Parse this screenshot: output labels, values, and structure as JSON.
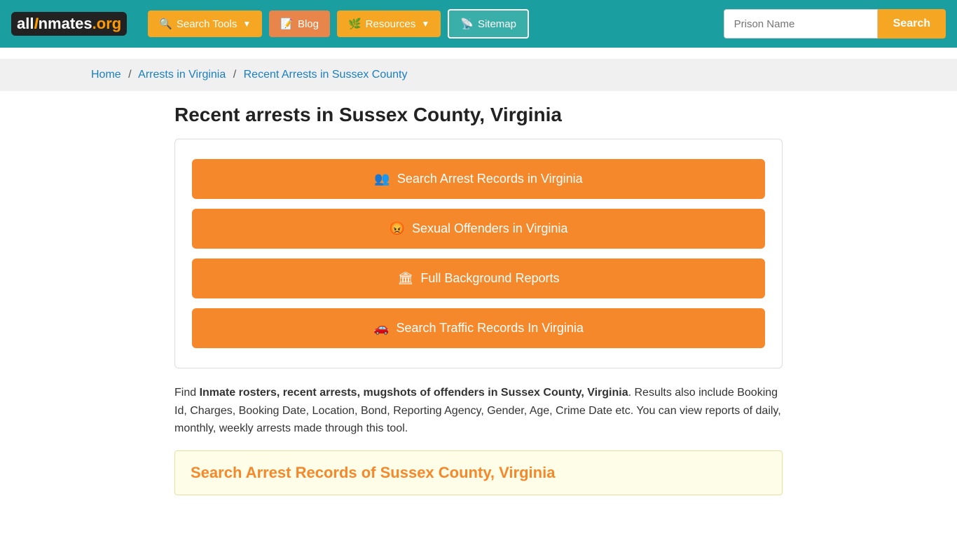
{
  "nav": {
    "logo_all": "all",
    "logo_inmates": "Inmates",
    "logo_org": ".org",
    "search_tools": "Search Tools",
    "blog": "Blog",
    "resources": "Resources",
    "sitemap": "Sitemap",
    "prison_name_placeholder": "Prison Name",
    "search_btn": "Search"
  },
  "breadcrumb": {
    "home": "Home",
    "arrests_in_virginia": "Arrests in Virginia",
    "current": "Recent Arrests in Sussex County"
  },
  "page": {
    "title": "Recent arrests in Sussex County, Virginia",
    "buttons": [
      {
        "id": "search-arrest",
        "icon": "users",
        "label": "Search Arrest Records in Virginia"
      },
      {
        "id": "sexual-offenders",
        "icon": "angry",
        "label": "Sexual Offenders in Virginia"
      },
      {
        "id": "background-reports",
        "icon": "building",
        "label": "Full Background Reports"
      },
      {
        "id": "traffic-records",
        "icon": "car",
        "label": "Search Traffic Records In Virginia"
      }
    ],
    "desc_part1": "Find ",
    "desc_bold": "Inmate rosters, recent arrests, mugshots of offenders in Sussex County, Virginia",
    "desc_part2": ". Results also include Booking Id, Charges, Booking Date, Location, Bond, Reporting Agency, Gender, Age, Crime Date etc. You can view reports of daily, monthly, weekly arrests made through this tool.",
    "section_heading": "Search Arrest Records of Sussex County, Virginia"
  }
}
